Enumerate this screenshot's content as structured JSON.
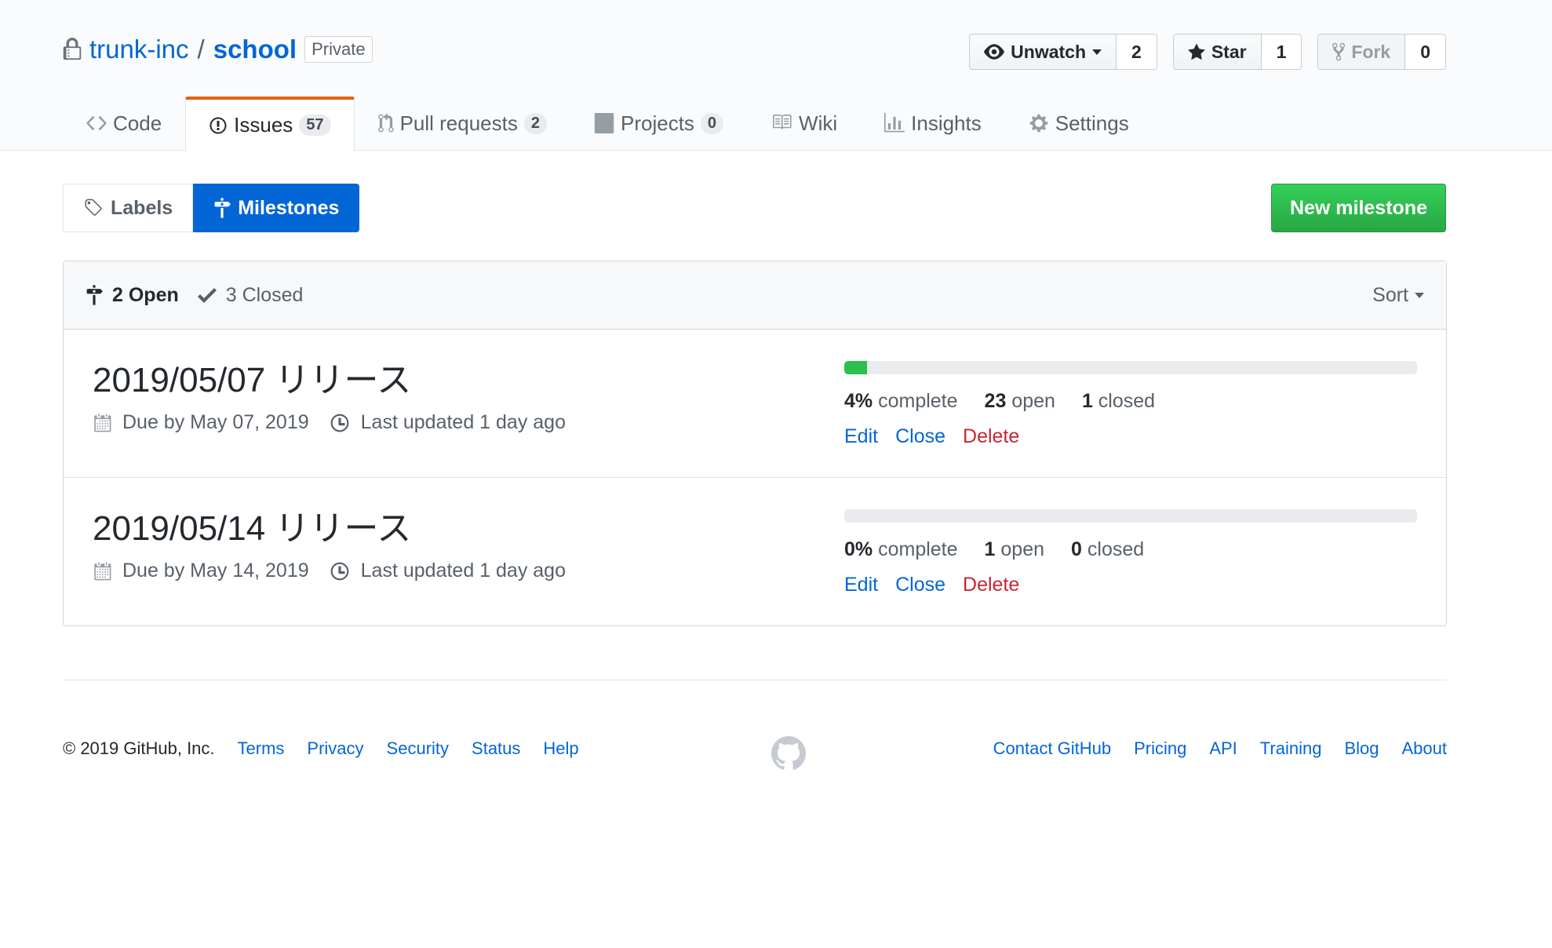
{
  "repo": {
    "owner": "trunk-inc",
    "separator": "/",
    "name": "school",
    "visibility": "Private"
  },
  "actions": {
    "watch": {
      "label": "Unwatch",
      "count": "2"
    },
    "star": {
      "label": "Star",
      "count": "1"
    },
    "fork": {
      "label": "Fork",
      "count": "0"
    }
  },
  "nav": {
    "code": {
      "label": "Code"
    },
    "issues": {
      "label": "Issues",
      "count": "57"
    },
    "pulls": {
      "label": "Pull requests",
      "count": "2"
    },
    "projects": {
      "label": "Projects",
      "count": "0"
    },
    "wiki": {
      "label": "Wiki"
    },
    "insights": {
      "label": "Insights"
    },
    "settings": {
      "label": "Settings"
    }
  },
  "subnav": {
    "labels": "Labels",
    "milestones": "Milestones",
    "new_milestone": "New milestone"
  },
  "list_header": {
    "open": "2 Open",
    "closed": "3 Closed",
    "sort": "Sort"
  },
  "milestones": [
    {
      "title": "2019/05/07 リリース",
      "due": "Due by May 07, 2019",
      "updated": "Last updated 1 day ago",
      "percent_value": 4,
      "percent": "4%",
      "complete_label": "complete",
      "open_count": "23",
      "open_label": "open",
      "closed_count": "1",
      "closed_label": "closed",
      "edit": "Edit",
      "close": "Close",
      "delete": "Delete"
    },
    {
      "title": "2019/05/14 リリース",
      "due": "Due by May 14, 2019",
      "updated": "Last updated 1 day ago",
      "percent_value": 0,
      "percent": "0%",
      "complete_label": "complete",
      "open_count": "1",
      "open_label": "open",
      "closed_count": "0",
      "closed_label": "closed",
      "edit": "Edit",
      "close": "Close",
      "delete": "Delete"
    }
  ],
  "footer": {
    "copyright": "© 2019 GitHub, Inc.",
    "left_links": [
      "Terms",
      "Privacy",
      "Security",
      "Status",
      "Help"
    ],
    "right_links": [
      "Contact GitHub",
      "Pricing",
      "API",
      "Training",
      "Blog",
      "About"
    ]
  },
  "colors": {
    "link": "#0366d6",
    "accent_tab": "#e36209",
    "selected_subnav": "#0366d6",
    "new_button": "#28a745",
    "progress": "#2cbe4e",
    "danger": "#cb2431"
  }
}
